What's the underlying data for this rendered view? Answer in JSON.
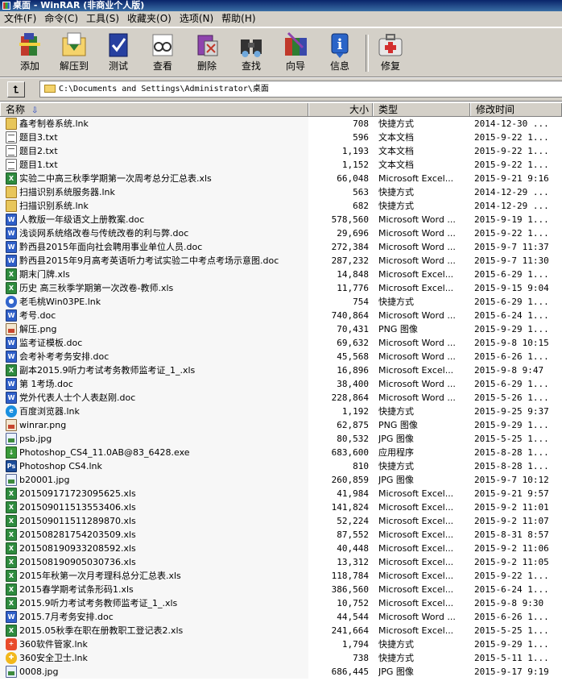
{
  "window": {
    "title": "桌面 - WinRAR (非商业个人版)"
  },
  "menu": [
    "文件(F)",
    "命令(C)",
    "工具(S)",
    "收藏夹(O)",
    "选项(N)",
    "帮助(H)"
  ],
  "toolbar": {
    "buttons": [
      {
        "label": "添加",
        "icon": "add-archive-icon"
      },
      {
        "label": "解压到",
        "icon": "extract-to-icon"
      },
      {
        "label": "测试",
        "icon": "test-icon"
      },
      {
        "label": "查看",
        "icon": "view-icon"
      },
      {
        "label": "删除",
        "icon": "delete-icon"
      },
      {
        "label": "查找",
        "icon": "find-icon"
      },
      {
        "label": "向导",
        "icon": "wizard-icon"
      },
      {
        "label": "信息",
        "icon": "info-icon"
      },
      {
        "label": "修复",
        "icon": "repair-icon"
      }
    ]
  },
  "address": {
    "path": "C:\\Documents and Settings\\Administrator\\桌面"
  },
  "columns": {
    "name": "名称",
    "size": "大小",
    "type": "类型",
    "modified": "修改时间"
  },
  "files": [
    {
      "name": "鑫考制卷系统.lnk",
      "size": "708",
      "type": "快捷方式",
      "modified": "2014-12-30 ...",
      "icon": "lnk"
    },
    {
      "name": "题目3.txt",
      "size": "596",
      "type": "文本文档",
      "modified": "2015-9-22 1...",
      "icon": "txt"
    },
    {
      "name": "题目2.txt",
      "size": "1,193",
      "type": "文本文档",
      "modified": "2015-9-22 1...",
      "icon": "txt"
    },
    {
      "name": "题目1.txt",
      "size": "1,152",
      "type": "文本文档",
      "modified": "2015-9-22 1...",
      "icon": "txt"
    },
    {
      "name": "实验二中高三秋季学期第一次周考总分汇总表.xls",
      "size": "66,048",
      "type": "Microsoft Excel...",
      "modified": "2015-9-21 9:16",
      "icon": "xls"
    },
    {
      "name": "扫描识别系统服务器.lnk",
      "size": "563",
      "type": "快捷方式",
      "modified": "2014-12-29 ...",
      "icon": "lnk"
    },
    {
      "name": "扫描识别系统.lnk",
      "size": "682",
      "type": "快捷方式",
      "modified": "2014-12-29 ...",
      "icon": "lnk"
    },
    {
      "name": "人教版一年级语文上册教案.doc",
      "size": "578,560",
      "type": "Microsoft Word ...",
      "modified": "2015-9-19 1...",
      "icon": "doc"
    },
    {
      "name": "浅谈网系统络改卷与传统改卷的利与弊.doc",
      "size": "29,696",
      "type": "Microsoft Word ...",
      "modified": "2015-9-22 1...",
      "icon": "doc"
    },
    {
      "name": "黔西县2015年面向社会聘用事业单位人员.doc",
      "size": "272,384",
      "type": "Microsoft Word ...",
      "modified": "2015-9-7 11:37",
      "icon": "doc"
    },
    {
      "name": "黔西县2015年9月高考英语听力考试实验二中考点考场示意图.doc",
      "size": "287,232",
      "type": "Microsoft Word ...",
      "modified": "2015-9-7 11:30",
      "icon": "doc"
    },
    {
      "name": "期末门牌.xls",
      "size": "14,848",
      "type": "Microsoft Excel...",
      "modified": "2015-6-29 1...",
      "icon": "xls"
    },
    {
      "name": "历史 高三秋季学期第一次改卷-教师.xls",
      "size": "11,776",
      "type": "Microsoft Excel...",
      "modified": "2015-9-15 9:04",
      "icon": "xls"
    },
    {
      "name": "老毛桃Win03PE.lnk",
      "size": "754",
      "type": "快捷方式",
      "modified": "2015-6-29 1...",
      "icon": "app"
    },
    {
      "name": "考号.doc",
      "size": "740,864",
      "type": "Microsoft Word ...",
      "modified": "2015-6-24 1...",
      "icon": "doc"
    },
    {
      "name": "解压.png",
      "size": "70,431",
      "type": "PNG 图像",
      "modified": "2015-9-29 1...",
      "icon": "png"
    },
    {
      "name": "监考证模板.doc",
      "size": "69,632",
      "type": "Microsoft Word ...",
      "modified": "2015-9-8 10:15",
      "icon": "doc"
    },
    {
      "name": "会考补考考务安排.doc",
      "size": "45,568",
      "type": "Microsoft Word ...",
      "modified": "2015-6-26 1...",
      "icon": "doc"
    },
    {
      "name": "副本2015.9听力考试考务教师监考证_1_.xls",
      "size": "16,896",
      "type": "Microsoft Excel...",
      "modified": "2015-9-8 9:47",
      "icon": "xls"
    },
    {
      "name": "第 1考场.doc",
      "size": "38,400",
      "type": "Microsoft Word ...",
      "modified": "2015-6-29 1...",
      "icon": "doc"
    },
    {
      "name": "党外代表人士个人表赵刚.doc",
      "size": "228,864",
      "type": "Microsoft Word ...",
      "modified": "2015-5-26 1...",
      "icon": "doc"
    },
    {
      "name": "百度浏览器.lnk",
      "size": "1,192",
      "type": "快捷方式",
      "modified": "2015-9-25 9:37",
      "icon": "web"
    },
    {
      "name": "winrar.png",
      "size": "62,875",
      "type": "PNG 图像",
      "modified": "2015-9-29 1...",
      "icon": "png"
    },
    {
      "name": "psb.jpg",
      "size": "80,532",
      "type": "JPG 图像",
      "modified": "2015-5-25 1...",
      "icon": "jpg"
    },
    {
      "name": "Photoshop_CS4_11.0AB@83_6428.exe",
      "size": "683,600",
      "type": "应用程序",
      "modified": "2015-8-28 1...",
      "icon": "exe"
    },
    {
      "name": "Photoshop CS4.lnk",
      "size": "810",
      "type": "快捷方式",
      "modified": "2015-8-28 1...",
      "icon": "ps"
    },
    {
      "name": "b20001.jpg",
      "size": "260,859",
      "type": "JPG 图像",
      "modified": "2015-9-7 10:12",
      "icon": "jpg"
    },
    {
      "name": "20150917172309​5625.xls",
      "size": "41,984",
      "type": "Microsoft Excel...",
      "modified": "2015-9-21 9:57",
      "icon": "xls"
    },
    {
      "name": "20150901151355​3406.xls",
      "size": "141,824",
      "type": "Microsoft Excel...",
      "modified": "2015-9-2 11:01",
      "icon": "xls"
    },
    {
      "name": "20150901151128​9870.xls",
      "size": "52,224",
      "type": "Microsoft Excel...",
      "modified": "2015-9-2 11:07",
      "icon": "xls"
    },
    {
      "name": "20150828175420​3509.xls",
      "size": "87,552",
      "type": "Microsoft Excel...",
      "modified": "2015-8-31 8:57",
      "icon": "xls"
    },
    {
      "name": "20150819093320​8592.xls",
      "size": "40,448",
      "type": "Microsoft Excel...",
      "modified": "2015-9-2 11:06",
      "icon": "xls"
    },
    {
      "name": "20150819090503​0736.xls",
      "size": "13,312",
      "type": "Microsoft Excel...",
      "modified": "2015-9-2 11:05",
      "icon": "xls"
    },
    {
      "name": "2015年秋第一次月考理科总分汇总表.xls",
      "size": "118,784",
      "type": "Microsoft Excel...",
      "modified": "2015-9-22 1...",
      "icon": "xls"
    },
    {
      "name": "2015春学期考试条形码1.xls",
      "size": "386,560",
      "type": "Microsoft Excel...",
      "modified": "2015-6-24 1...",
      "icon": "xls"
    },
    {
      "name": "2015.9听力考试考务教师监考证_1_.xls",
      "size": "10,752",
      "type": "Microsoft Excel...",
      "modified": "2015-9-8 9:30",
      "icon": "xls"
    },
    {
      "name": "2015.7月考务安排.doc",
      "size": "44,544",
      "type": "Microsoft Word ...",
      "modified": "2015-6-26 1...",
      "icon": "doc"
    },
    {
      "name": "2015.05秋季在职在册教职工登记表2.xls",
      "size": "241,664",
      "type": "Microsoft Excel...",
      "modified": "2015-5-25 1...",
      "icon": "xls"
    },
    {
      "name": "360软件管家.lnk",
      "size": "1,794",
      "type": "快捷方式",
      "modified": "2015-9-29 1...",
      "icon": "360"
    },
    {
      "name": "360安全卫士.lnk",
      "size": "738",
      "type": "快捷方式",
      "modified": "2015-5-11 1...",
      "icon": "360g"
    },
    {
      "name": "0008.jpg",
      "size": "686,445",
      "type": "JPG 图像",
      "modified": "2015-9-17 9:19",
      "icon": "jpg"
    }
  ]
}
